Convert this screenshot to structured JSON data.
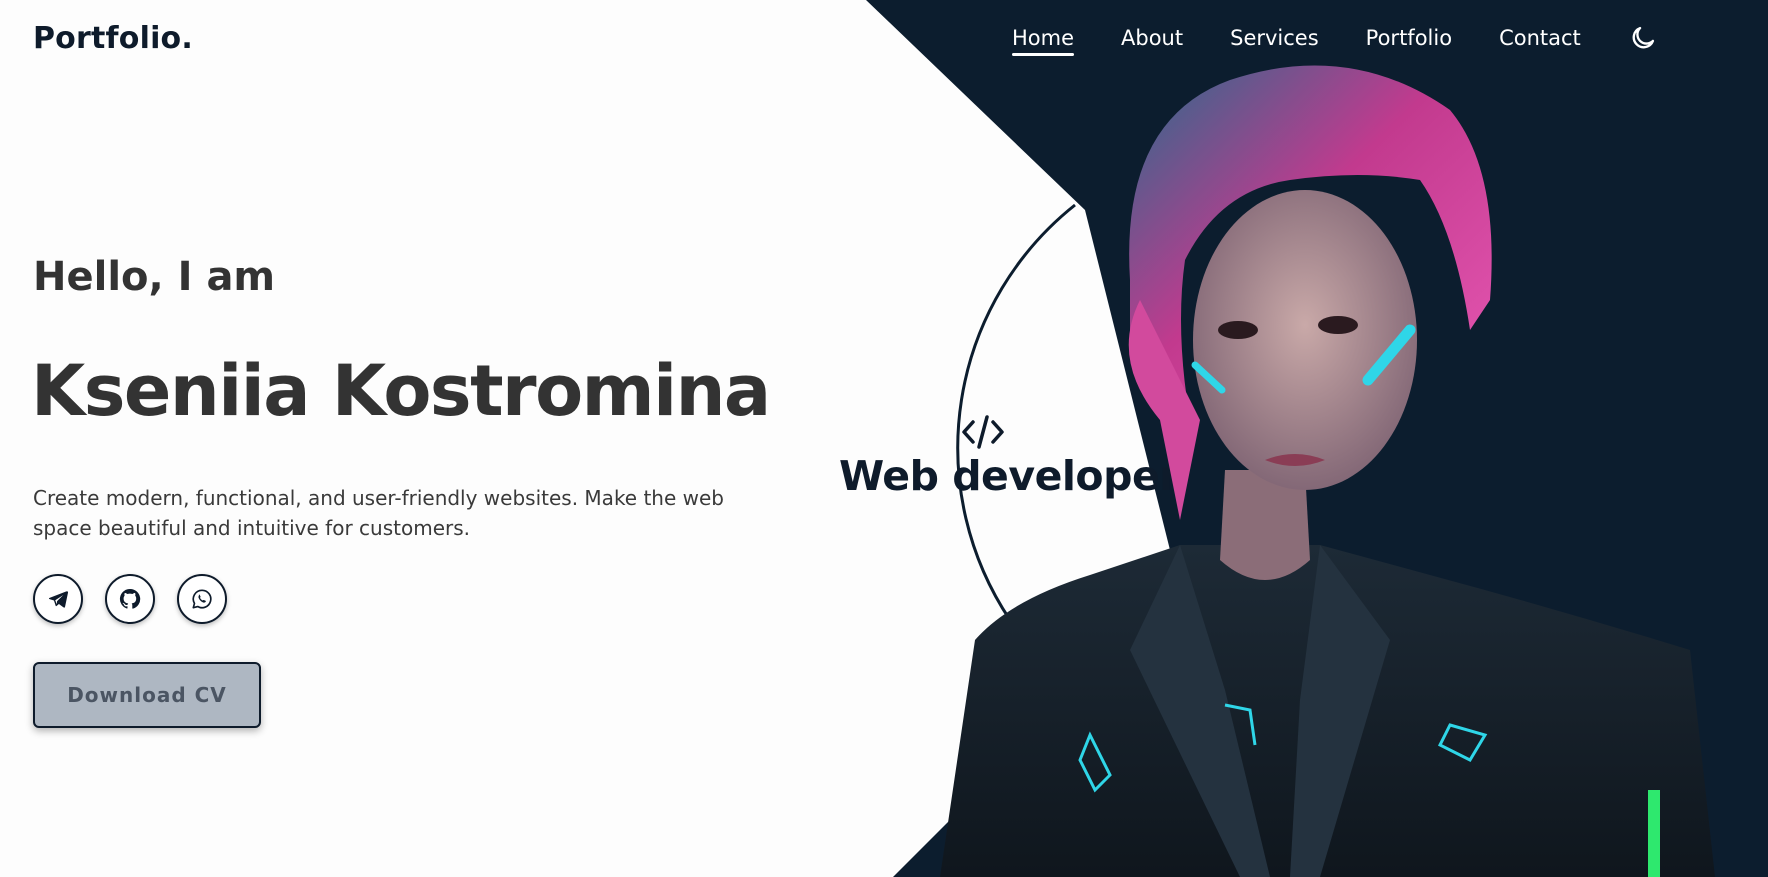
{
  "header": {
    "logo": "Portfolio.",
    "nav": [
      {
        "label": "Home",
        "active": true
      },
      {
        "label": "About",
        "active": false
      },
      {
        "label": "Services",
        "active": false
      },
      {
        "label": "Portfolio",
        "active": false
      },
      {
        "label": "Contact",
        "active": false
      }
    ],
    "theme_toggle_icon": "moon-icon"
  },
  "hero": {
    "greeting": "Hello, I am",
    "name": "Kseniia Kostromina",
    "description": "Create modern, functional, and user-friendly websites. Make the web space beautiful and intuitive for customers.",
    "socials": [
      {
        "icon": "telegram-icon"
      },
      {
        "icon": "github-icon"
      },
      {
        "icon": "whatsapp-icon"
      }
    ],
    "cta_label": "Download CV"
  },
  "role": {
    "icon": "code-icon",
    "title": "Web developer"
  },
  "colors": {
    "dark_navy": "#0e1b2b",
    "text_dark": "#333333",
    "button_bg": "#aeb7c2",
    "accent_pink": "#e04aa8",
    "accent_cyan": "#2fd6e8"
  }
}
